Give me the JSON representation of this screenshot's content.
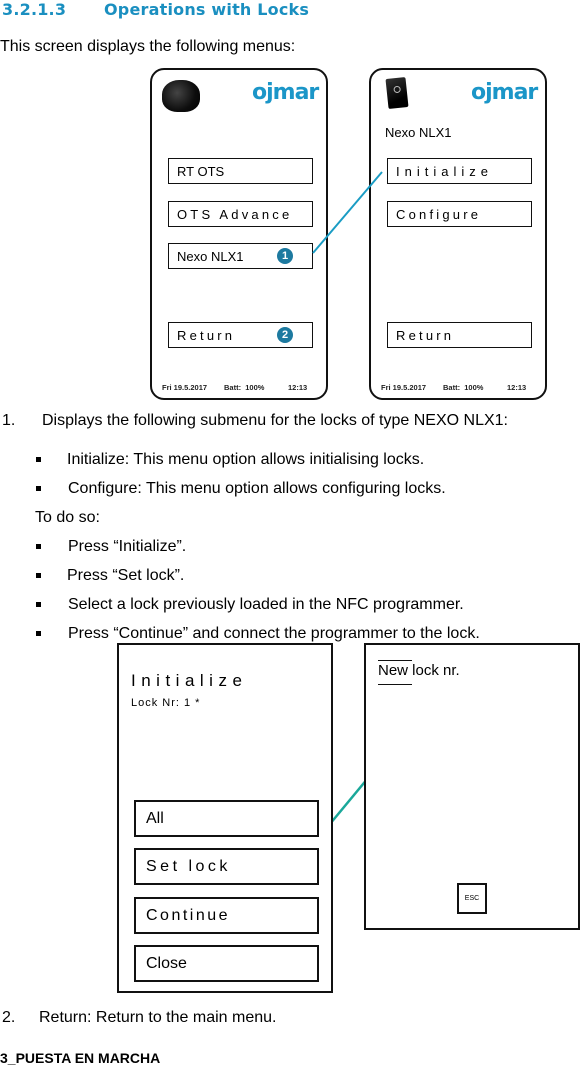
{
  "section": {
    "number": "3.2.1.3",
    "title": "Operations with Locks",
    "intro": "This screen displays the following menus:"
  },
  "colors": {
    "heading": "#1a8fc0",
    "logo": "#1b96c8",
    "badge": "#1d7aa0",
    "connector_top": "#1a9cc4",
    "connector_bottom": "#1aa89a"
  },
  "figure_top": {
    "screen_left": {
      "device_icon": "round-lock-icon",
      "logo": "ojmar",
      "buttons": [
        {
          "label": "RT OTS"
        },
        {
          "label": "OTS Advance"
        },
        {
          "label": "Nexo NLX1",
          "badge": "1"
        },
        {
          "label": "Return",
          "badge": "2"
        }
      ],
      "status": {
        "date": "Fri 19.5.2017",
        "battery": "Batt:  100%",
        "time": "12:13"
      }
    },
    "screen_right": {
      "device_icon": "card-lock-icon",
      "logo": "ojmar",
      "subtitle": "Nexo NLX1",
      "buttons": [
        {
          "label": "Initialize"
        },
        {
          "label": "Configure"
        },
        {
          "label": "Return"
        }
      ],
      "status": {
        "date": "Fri 19.5.2017",
        "battery": "Batt:  100%",
        "time": "12:13"
      }
    }
  },
  "list": {
    "item1": {
      "number": "1.",
      "text": "Displays the following submenu for the locks of type NEXO NLX1:",
      "bullets": [
        "Initialize: This menu option allows initialising locks.",
        "Configure: This menu option allows configuring locks."
      ],
      "todo_label": "To do so:",
      "steps": [
        "Press “Initialize”.",
        "Press “Set lock”.",
        "Select a lock previously loaded in the NFC programmer.",
        "Press “Continue” and connect the programmer to the lock."
      ]
    },
    "item2": {
      "number": "2.",
      "text": "Return: Return to the main menu."
    }
  },
  "figure_bottom": {
    "panel_left": {
      "title": "Initialize",
      "lock_nr": "Lock Nr: 1 *",
      "buttons": [
        {
          "label": "All"
        },
        {
          "label": "Set lock"
        },
        {
          "label": "Continue"
        },
        {
          "label": "Close"
        }
      ]
    },
    "panel_right": {
      "title": "New lock nr.",
      "esc_label": "ESC"
    }
  },
  "footer": {
    "chapter": "3_PUESTA EN MARCHA"
  }
}
